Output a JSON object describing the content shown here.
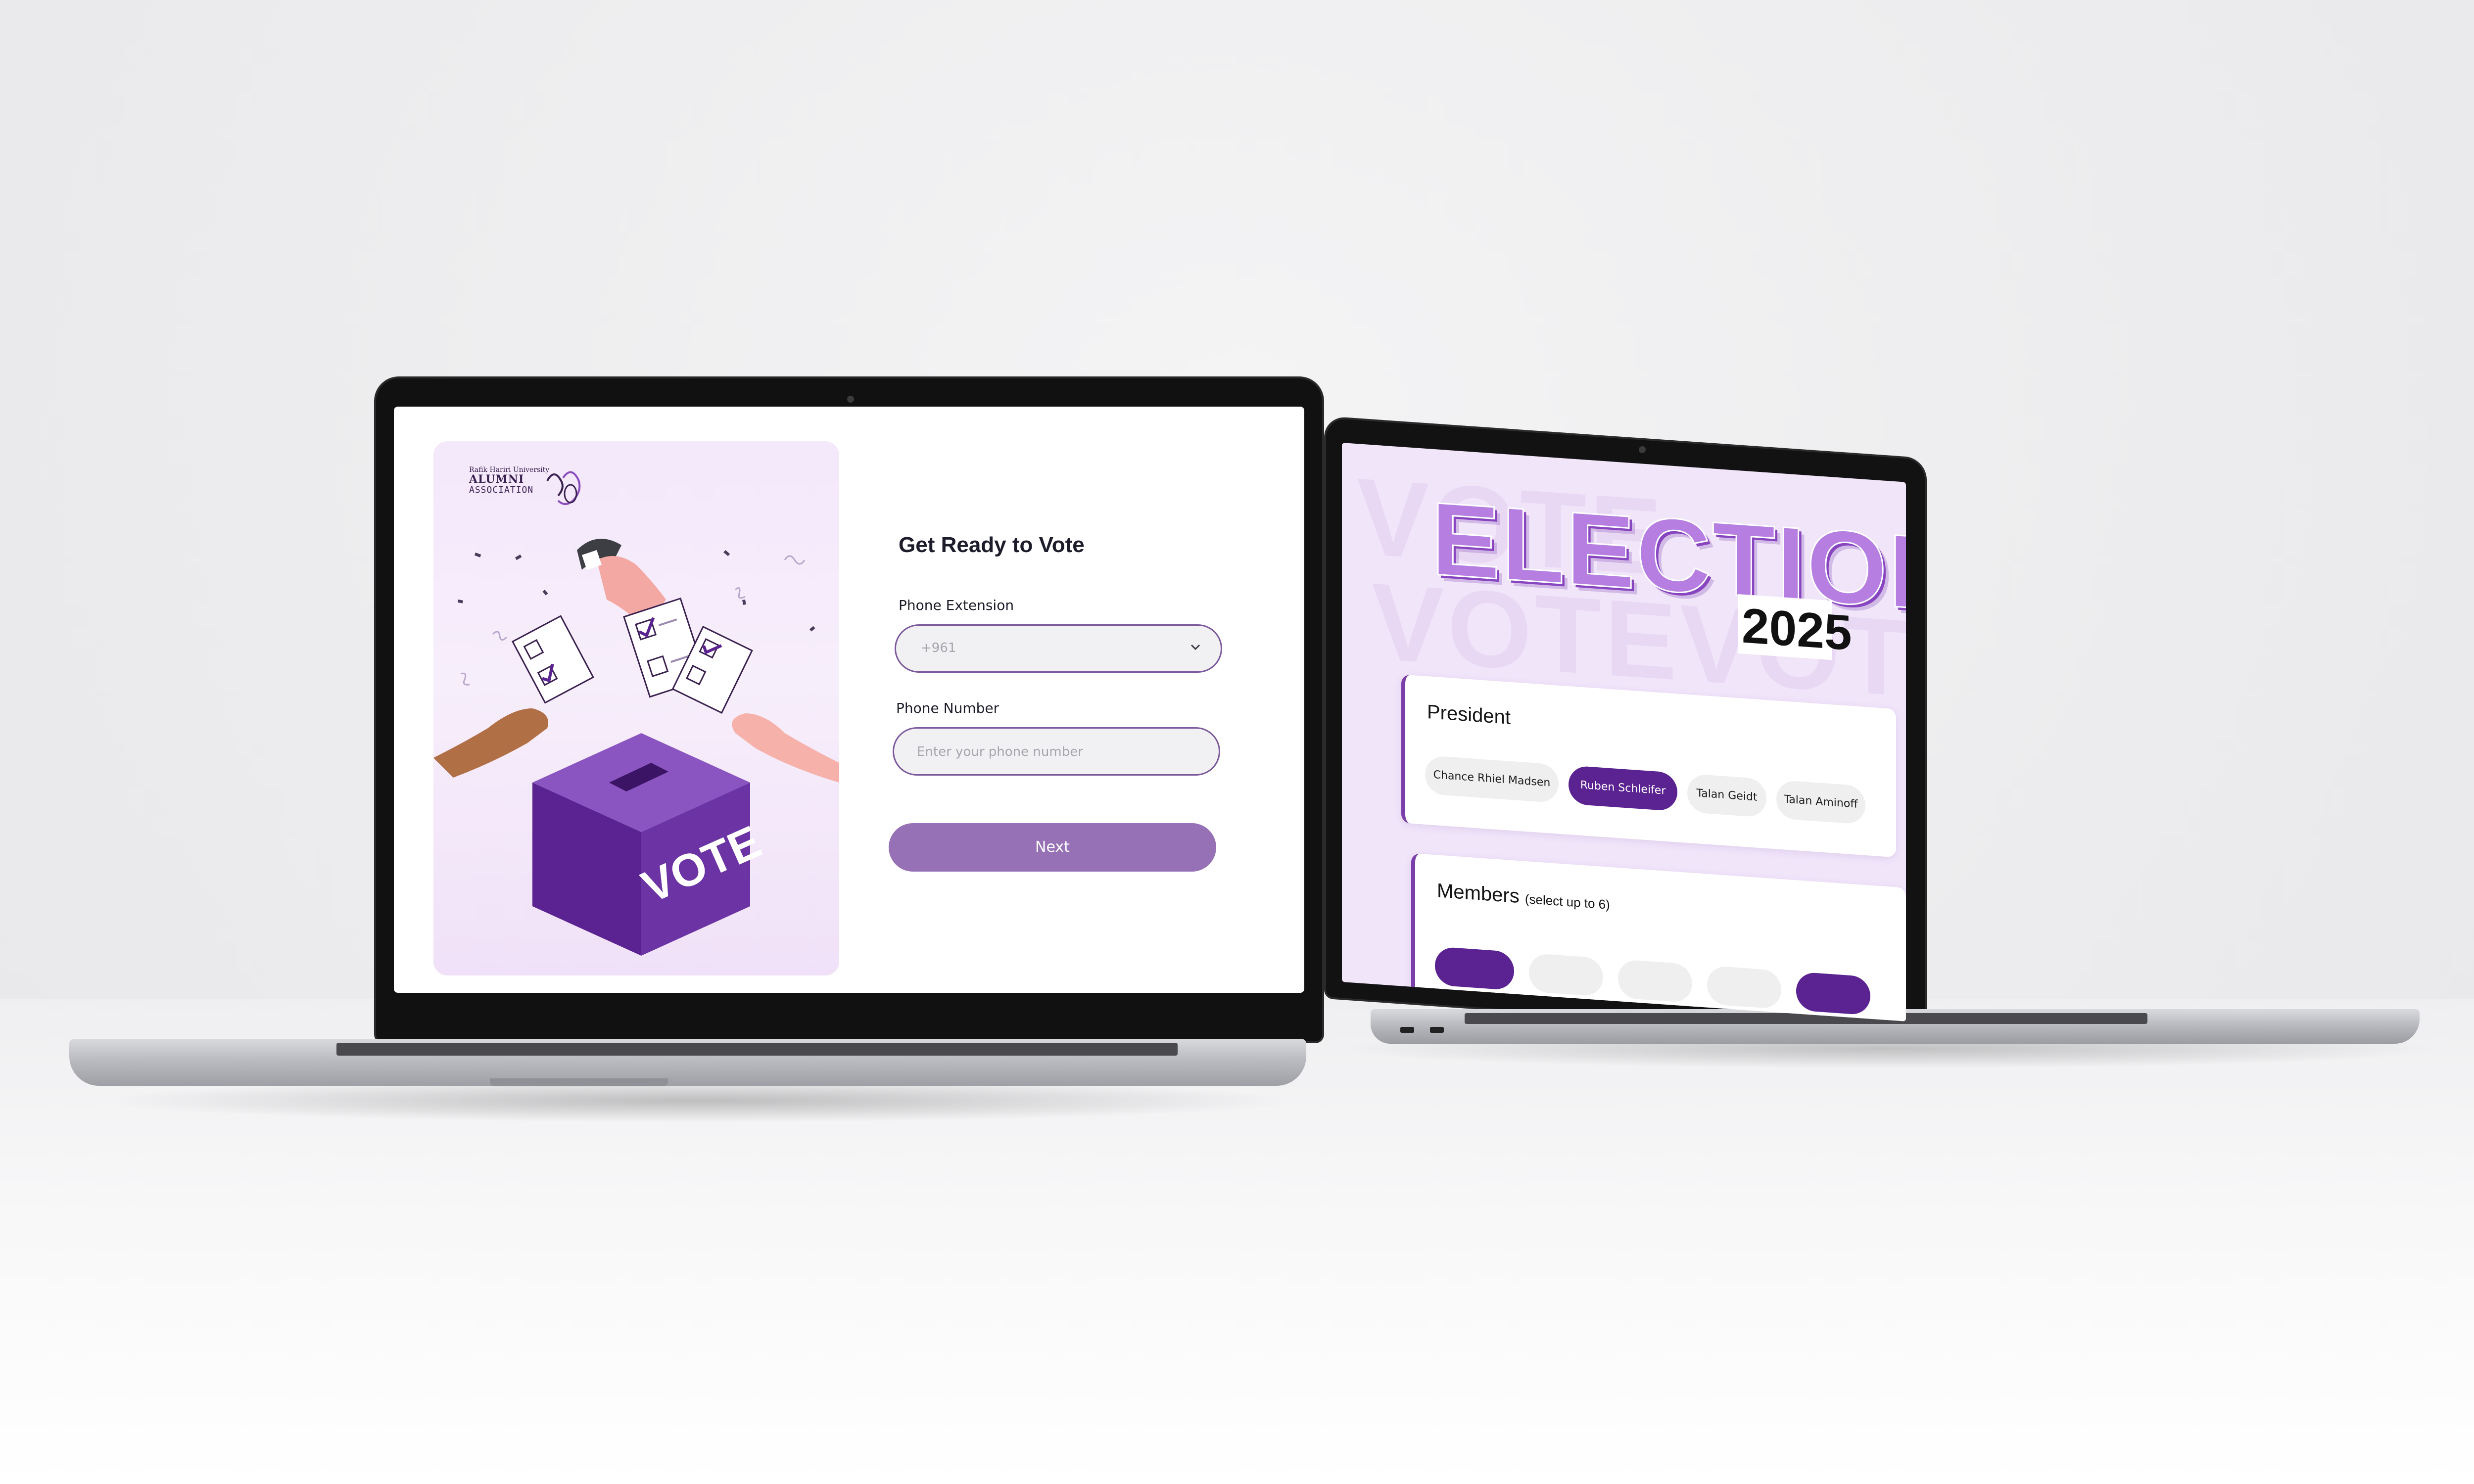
{
  "login_screen": {
    "logo": {
      "university": "Rafik Hariri University",
      "line1": "ALUMNI",
      "line2": "ASSOCIATION"
    },
    "illustration": {
      "ballot_box_text": "VOTE"
    },
    "title": "Get Ready to Vote",
    "phone_extension": {
      "label": "Phone Extension",
      "value": "+961"
    },
    "phone_number": {
      "label": "Phone Number",
      "placeholder": "Enter your phone number"
    },
    "next_button": "Next"
  },
  "elections_screen": {
    "title": "ELECTIONS",
    "year": "2025",
    "background_words": [
      "VOTE",
      "VOTEVOTE"
    ],
    "president": {
      "title": "President",
      "candidates": [
        {
          "name": "Chance Rhiel Madsen",
          "selected": false
        },
        {
          "name": "Ruben Schleifer",
          "selected": true
        },
        {
          "name": "Talan Geidt",
          "selected": false
        },
        {
          "name": "Talan Aminoff",
          "selected": false
        }
      ]
    },
    "members": {
      "title": "Members",
      "note": "(select up to 6)"
    }
  },
  "colors": {
    "accent": "#5b2391",
    "button": "#9671b5",
    "field_border": "#7c5a9c",
    "panel_bg": "#f4e8fb",
    "title_purple": "#b57ee0"
  }
}
